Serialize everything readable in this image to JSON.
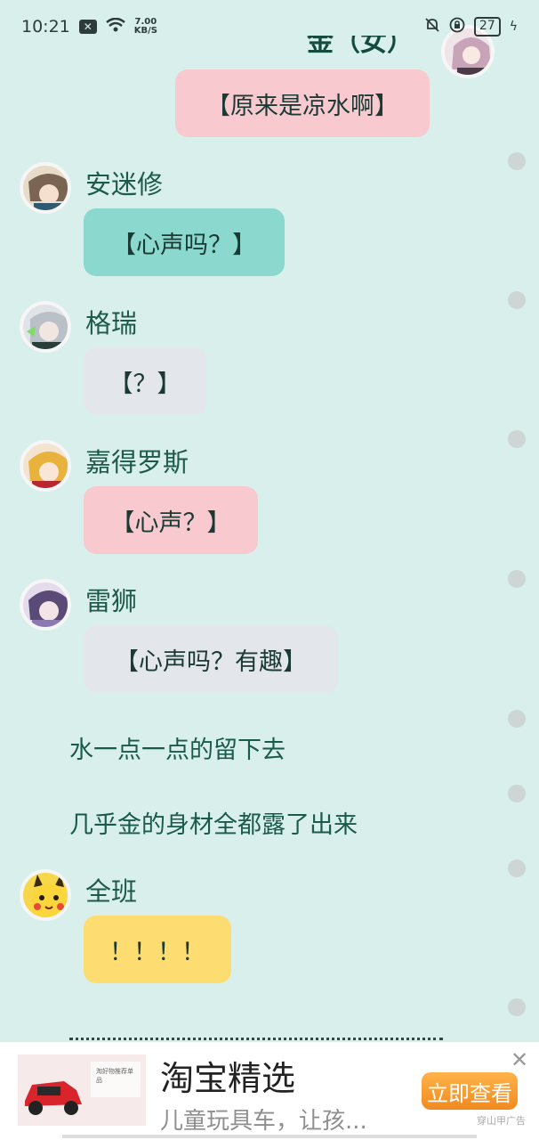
{
  "status_bar": {
    "time": "10:21",
    "net_speed_value": "7.00",
    "net_speed_unit": "KB/S",
    "battery": "27"
  },
  "chat": {
    "top_name_partial": "金（女）",
    "messages": [
      {
        "type": "bubble_self",
        "text": "【原来是凉水啊】",
        "bg": "#f9c9d0"
      },
      {
        "type": "bubble",
        "name": "安迷修",
        "text": "【心声吗？】",
        "bg": "#8bd9ce"
      },
      {
        "type": "bubble",
        "name": "格瑞",
        "text": "【？】",
        "bg": "#e3e6ea"
      },
      {
        "type": "bubble",
        "name": "嘉得罗斯",
        "text": "【心声？】",
        "bg": "#f9c9d0"
      },
      {
        "type": "bubble",
        "name": "雷狮",
        "text": "【心声吗？有趣】",
        "bg": "#e3e6ea"
      },
      {
        "type": "narration",
        "text": "水一点一点的留下去"
      },
      {
        "type": "narration",
        "text": "几乎金的身材全都露了出来"
      },
      {
        "type": "bubble",
        "name": "全班",
        "text": "！！！！",
        "bg": "#fddd72"
      }
    ]
  },
  "ad": {
    "title": "淘宝精选",
    "subtitle": "儿童玩具车，让孩...",
    "button": "立即查看",
    "close": "✕",
    "source": "穿山甲广告",
    "thumb_caption": "淘好物推荐单品"
  }
}
